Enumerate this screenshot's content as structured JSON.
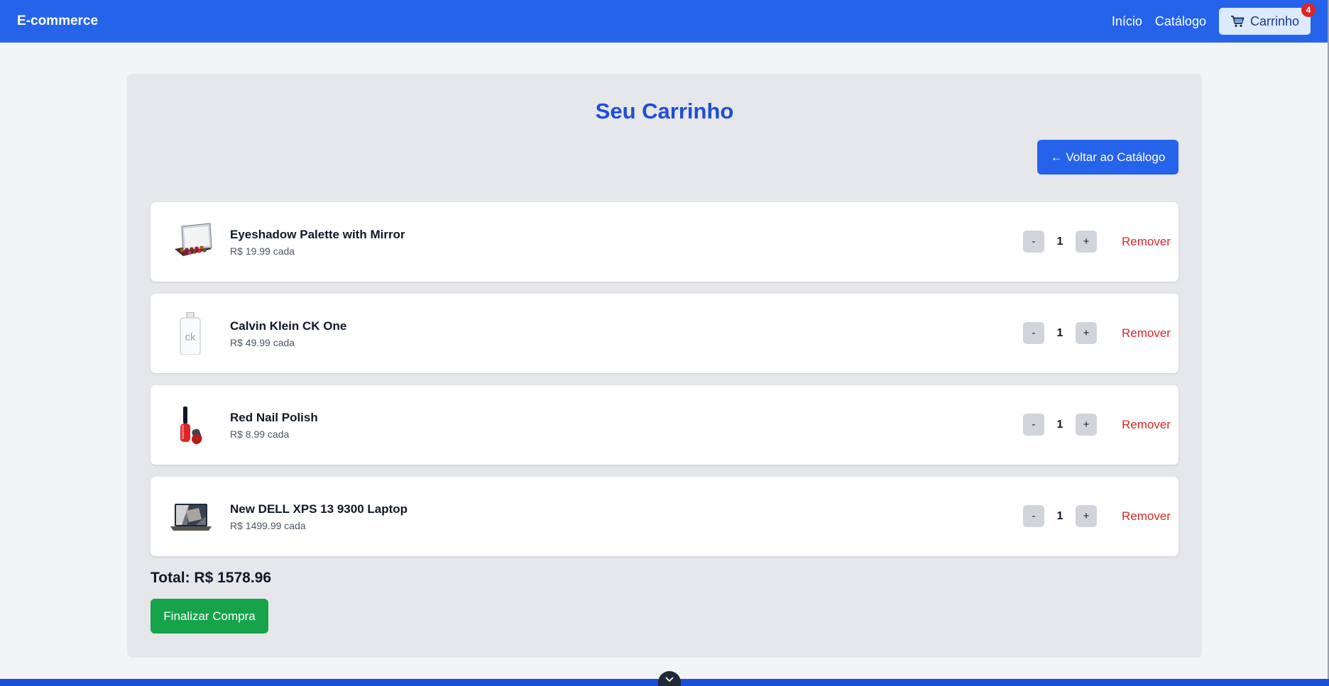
{
  "navbar": {
    "brand": "E-commerce",
    "links": [
      {
        "label": "Início"
      },
      {
        "label": "Catálogo"
      }
    ],
    "cart_label": "Carrinho",
    "cart_count": "4"
  },
  "cart": {
    "title": "Seu Carrinho",
    "back_label": "← Voltar ao Catálogo",
    "items": [
      {
        "name": "Eyeshadow Palette with Mirror",
        "price": "R$ 19.99 cada",
        "qty": "1",
        "minus": "-",
        "plus": "+",
        "remove": "Remover",
        "icon": "eyeshadow-palette-image"
      },
      {
        "name": "Calvin Klein CK One",
        "price": "R$ 49.99 cada",
        "qty": "1",
        "minus": "-",
        "plus": "+",
        "remove": "Remover",
        "icon": "perfume-bottle-image"
      },
      {
        "name": "Red Nail Polish",
        "price": "R$ 8.99 cada",
        "qty": "1",
        "minus": "-",
        "plus": "+",
        "remove": "Remover",
        "icon": "nail-polish-image"
      },
      {
        "name": "New DELL XPS 13 9300 Laptop",
        "price": "R$ 1499.99 cada",
        "qty": "1",
        "minus": "-",
        "plus": "+",
        "remove": "Remover",
        "icon": "laptop-image"
      }
    ],
    "total": "Total: R$ 1578.96",
    "checkout_label": "Finalizar Compra"
  },
  "colors": {
    "primary": "#2563eb",
    "title": "#1d4ed8",
    "danger": "#dc2626",
    "success": "#16a34a"
  }
}
